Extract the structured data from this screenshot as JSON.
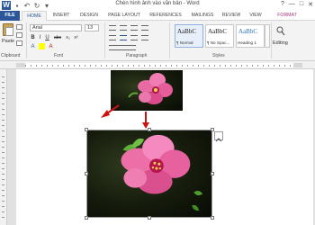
{
  "title_bar": {
    "app_icon": "word-logo",
    "app_letter": "W",
    "document_title": "Chèn hình ảnh vào văn bản - Word",
    "controls": [
      "?",
      "—",
      "□",
      "✕"
    ]
  },
  "tabs": [
    {
      "label": "FILE",
      "active": false
    },
    {
      "label": "HOME",
      "active": true
    },
    {
      "label": "INSERT",
      "active": false
    },
    {
      "label": "DESIGN",
      "active": false
    },
    {
      "label": "PAGE LAYOUT",
      "active": false
    },
    {
      "label": "REFERENCES",
      "active": false
    },
    {
      "label": "MAILINGS",
      "active": false
    },
    {
      "label": "REVIEW",
      "active": false
    },
    {
      "label": "VIEW",
      "active": false
    },
    {
      "label": "FORMAT",
      "active": false,
      "contextual": true
    }
  ],
  "ribbon": {
    "clipboard": {
      "paste_label": "Paste",
      "group_label": "Clipboard"
    },
    "font": {
      "font_name": "Arial",
      "font_size": "13",
      "group_label": "Font",
      "bold": "B",
      "italic": "I",
      "underline": "U",
      "strike": "abc",
      "sub": "x₂",
      "sup": "x²",
      "color_a": "A"
    },
    "paragraph": {
      "group_label": "Paragraph"
    },
    "styles": {
      "group_label": "Styles",
      "items": [
        {
          "sample": "AaBbC",
          "name": "¶ Normal"
        },
        {
          "sample": "AaBbC",
          "name": "¶ No Spac..."
        },
        {
          "sample": "AaBbC",
          "name": "Heading 1"
        }
      ]
    },
    "editing": {
      "label": "Editing"
    }
  },
  "colors": {
    "file_tab": "#2b579a",
    "format_tab": "#a2367a",
    "annotation_arrow": "#cc1111"
  }
}
